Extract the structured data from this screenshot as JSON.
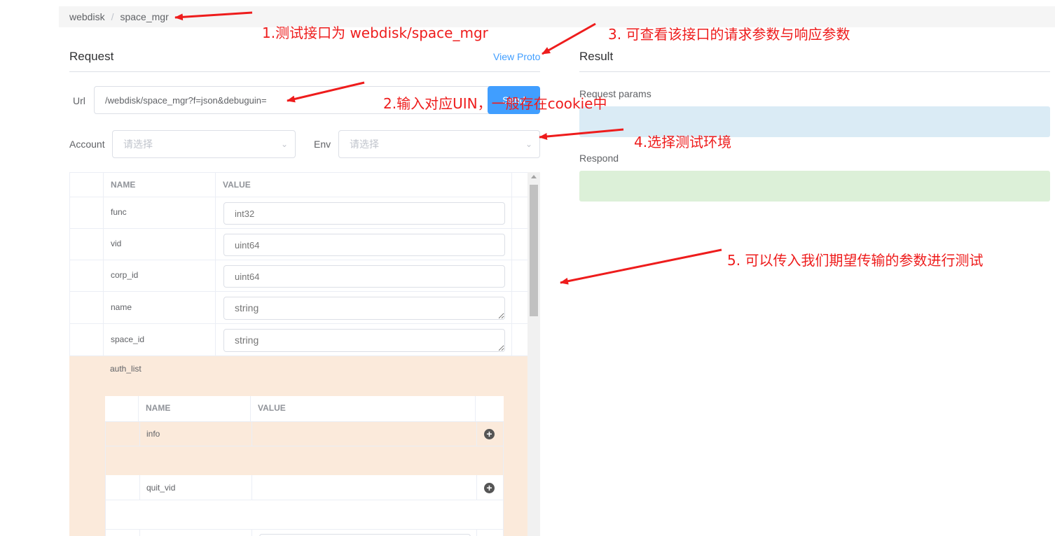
{
  "breadcrumb": {
    "item1": "webdisk",
    "separator": "/",
    "item2": "space_mgr"
  },
  "request": {
    "title": "Request",
    "view_proto": "View Proto"
  },
  "result": {
    "title": "Result",
    "params_label": "Request params",
    "respond_label": "Respond",
    "params_bg": "#daebf5",
    "respond_bg": "#dcf0d8"
  },
  "url": {
    "label": "Url",
    "value": "/webdisk/space_mgr?f=json&debuguin=",
    "send_label": "Send"
  },
  "account": {
    "label": "Account",
    "placeholder": "请选择"
  },
  "env": {
    "label": "Env",
    "placeholder": "请选择"
  },
  "table": {
    "header": {
      "name": "NAME",
      "value": "VALUE"
    },
    "rows": [
      {
        "name": "func",
        "placeholder": "int32"
      },
      {
        "name": "vid",
        "placeholder": "uint64"
      },
      {
        "name": "corp_id",
        "placeholder": "uint64"
      },
      {
        "name": "name",
        "placeholder": "string"
      },
      {
        "name": "space_id",
        "placeholder": "string"
      }
    ],
    "nested": {
      "name": "auth_list",
      "header": {
        "name": "NAME",
        "value": "VALUE"
      },
      "rows": [
        {
          "name": "info"
        },
        {
          "name": "quit_vid"
        }
      ]
    }
  },
  "annotations": [
    "1.测试接口为 webdisk/space_mgr",
    "2.输入对应UIN，一般存在cookie中",
    "3. 可查看该接口的请求参数与响应参数",
    "4.选择测试环境",
    "5. 可以传入我们期望传输的参数进行测试"
  ],
  "colors": {
    "accent": "#409eff",
    "annotation": "#ee1c1c",
    "highlight_row": "#fbeadb"
  }
}
